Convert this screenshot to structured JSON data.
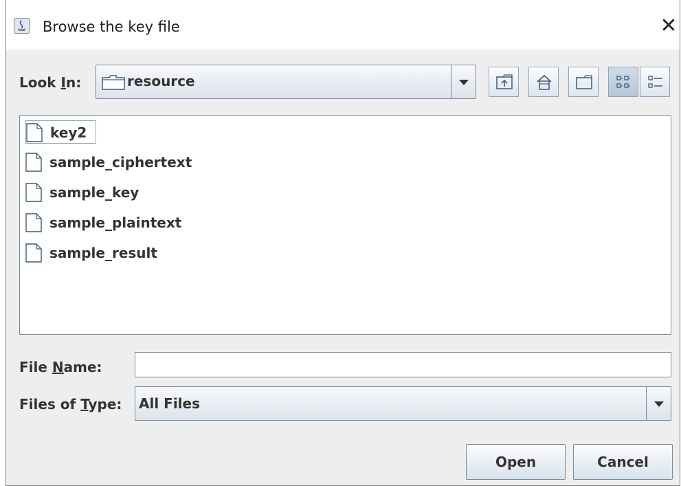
{
  "window": {
    "title": "Browse the key file"
  },
  "look_in": {
    "label_prefix": "Look ",
    "label_mnemonic": "I",
    "label_suffix": "n:",
    "selected": "resource"
  },
  "toolbar": [
    "up-one-level",
    "home",
    "new-folder",
    "list-view",
    "details-view"
  ],
  "files": [
    {
      "name": "key2"
    },
    {
      "name": "sample_ciphertext"
    },
    {
      "name": "sample_key"
    },
    {
      "name": "sample_plaintext"
    },
    {
      "name": "sample_result"
    }
  ],
  "file_name": {
    "label_prefix": "File ",
    "label_mnemonic": "N",
    "label_suffix": "ame:",
    "value": ""
  },
  "file_type": {
    "label_prefix": "Files of ",
    "label_mnemonic": "T",
    "label_suffix": "ype:",
    "selected": "All Files"
  },
  "buttons": {
    "open": "Open",
    "cancel": "Cancel"
  }
}
